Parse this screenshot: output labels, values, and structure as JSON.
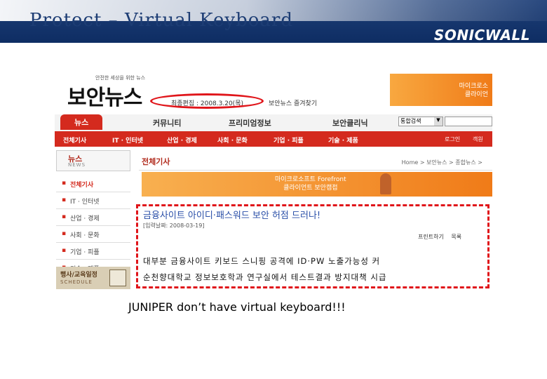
{
  "slide": {
    "title": "Protect – Virtual Keyboard",
    "logo": "SONICWALL",
    "caption": "JUNIPER don’t have virtual keyboard!!!"
  },
  "site": {
    "slogan": "안전한 세상을 위한 뉴스",
    "logo": "보안뉴스",
    "date": "최종편집 : 2008.3.20(목)",
    "bookmark": "보안뉴스 즐겨찾기",
    "ad_top": "마이크로소\n클라이언"
  },
  "nav": {
    "items": [
      "뉴스",
      "커뮤니티",
      "프리미엄정보",
      "보안클리닉"
    ],
    "select_value": "통합검색"
  },
  "subnav": {
    "items": [
      "전체기사",
      "IT · 인터넷",
      "산업 · 경제",
      "사회 · 문화",
      "기업 · 피플",
      "기술 · 제품"
    ],
    "login": "로그인",
    "extra": "객원"
  },
  "sidebar": {
    "title": "뉴스",
    "title_en": "NEWS",
    "items": [
      "전체기사",
      "IT · 인터넷",
      "산업 · 경제",
      "사회 · 문화",
      "기업 · 피플",
      "기술 · 제품"
    ],
    "banner_title": "행사/교육일정",
    "banner_en": "SCHEDULE"
  },
  "content": {
    "heading": "전체기사",
    "breadcrumb": "Home > 보안뉴스 > 종합뉴스 >",
    "banner_line1": "마이크로소프트 Forefront",
    "banner_line2": "클라이언트 보안캠접",
    "article_title": "금융사이트 아이디·패스워드 보안 허점 드러나!",
    "article_date": "[입력날짜: 2008-03-19]",
    "print_label": "프린트하기",
    "list_label": "목록",
    "lines": [
      "대부분 금융사이트 키보드 스니핑 공격에 ID·PW 노출가능성 커",
      "순천향대학교 정보보호학과 연구실에서 테스트결과 방지대책 시급"
    ]
  },
  "colors": {
    "header_blue": "#0e2d63",
    "site_red": "#d42a1e",
    "highlight_red": "#e0151a",
    "ad_orange": "#f07b18",
    "article_blue": "#2a4fa8"
  }
}
